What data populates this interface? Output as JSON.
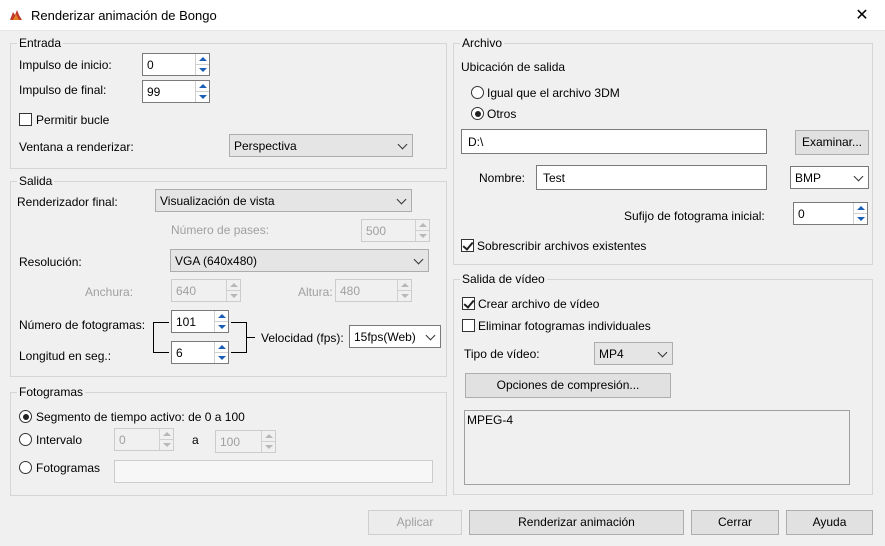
{
  "window": {
    "title": "Renderizar animación de Bongo",
    "close_glyph": "✕"
  },
  "entrada": {
    "legend": "Entrada",
    "impulso_inicio_label": "Impulso de inicio:",
    "impulso_inicio_value": "0",
    "impulso_final_label": "Impulso de final:",
    "impulso_final_value": "99",
    "permitir_bucle_label": "Permitir bucle",
    "permitir_bucle_checked": false,
    "ventana_label": "Ventana a renderizar:",
    "ventana_value": "Perspectiva"
  },
  "salida": {
    "legend": "Salida",
    "renderizador_label": "Renderizador final:",
    "renderizador_value": "Visualización de vista",
    "pases_label": "Número de pases:",
    "pases_value": "500",
    "resolucion_label": "Resolución:",
    "resolucion_value": "VGA (640x480)",
    "anchura_label": "Anchura:",
    "anchura_value": "640",
    "altura_label": "Altura:",
    "altura_value": "480",
    "num_fotogramas_label": "Número de fotogramas:",
    "num_fotogramas_value": "101",
    "longitud_label": "Longitud en seg.:",
    "longitud_value": "6",
    "velocidad_label": "Velocidad (fps):",
    "velocidad_value": "15fps(Web)"
  },
  "fotogramas": {
    "legend": "Fotogramas",
    "segmento_label": "Segmento de tiempo activo: de 0 a 100",
    "intervalo_label": "Intervalo",
    "intervalo_from": "0",
    "intervalo_a": "a",
    "intervalo_to": "100",
    "fotogramas_label": "Fotogramas",
    "fotogramas_value": "",
    "selected": "segmento"
  },
  "archivo": {
    "legend": "Archivo",
    "ubicacion_label": "Ubicación de salida",
    "igual_label": "Igual que el archivo 3DM",
    "otros_label": "Otros",
    "selected": "otros",
    "path_value": "D:\\",
    "examinar_label": "Examinar...",
    "nombre_label": "Nombre:",
    "nombre_value": "Test",
    "formato_value": "BMP",
    "sufijo_label": "Sufijo de fotograma inicial:",
    "sufijo_value": "0",
    "sobrescribir_label": "Sobrescribir archivos existentes",
    "sobrescribir_checked": true
  },
  "video": {
    "legend": "Salida de vídeo",
    "crear_label": "Crear archivo de vídeo",
    "crear_checked": true,
    "eliminar_label": "Eliminar fotogramas individuales",
    "eliminar_checked": false,
    "tipo_label": "Tipo de vídeo:",
    "tipo_value": "MP4",
    "compresion_label": "Opciones de compresión...",
    "codec_text": "MPEG-4"
  },
  "footer": {
    "aplicar_label": "Aplicar",
    "renderizar_label": "Renderizar animación",
    "cerrar_label": "Cerrar",
    "ayuda_label": "Ayuda"
  },
  "colors": {
    "accent": "#1a5fb4",
    "app_icon": "#c0392b"
  }
}
